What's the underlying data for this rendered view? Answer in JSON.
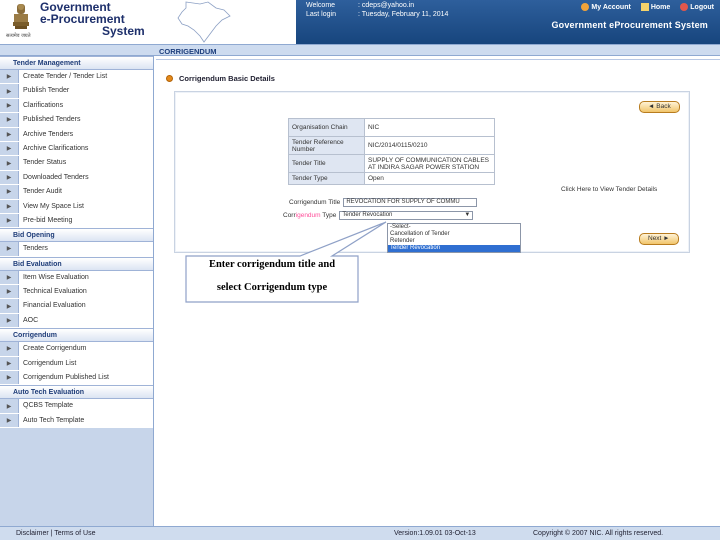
{
  "header": {
    "brand_line1": "Government",
    "brand_line2": "e-Procurement",
    "brand_line3": "System",
    "emblem_caption": "सत्यमेव जयते",
    "welcome_key": "Welcome",
    "welcome_value": ": cdeps@yahoo.in",
    "last_login_key": "Last login",
    "last_login_value": ": Tuesday, February 11, 2014",
    "links": [
      "My Account",
      "Home",
      "Logout"
    ],
    "system_title": "Government eProcurement System"
  },
  "sidebar": {
    "sections": [
      {
        "title": "Tender Management",
        "items": [
          "Create Tender / Tender List",
          "Publish Tender",
          "Clarifications",
          "Published Tenders",
          "Archive Tenders",
          "Archive Clarifications",
          "Tender Status",
          "Downloaded Tenders",
          "Tender Audit",
          "View My Space List",
          "Pre-bid Meeting"
        ]
      },
      {
        "title": "Bid Opening",
        "items": [
          "Tenders"
        ]
      },
      {
        "title": "Bid Evaluation",
        "items": [
          "Item Wise Evaluation",
          "Technical Evaluation",
          "Financial Evaluation",
          "AOC"
        ]
      },
      {
        "title": "Corrigendum",
        "items": [
          "Create Corrigendum",
          "Corrigendum List",
          "Corrigendum Published List"
        ]
      },
      {
        "title": "Auto Tech Evaluation",
        "items": [
          "QCBS Template",
          "Auto Tech Template"
        ]
      }
    ]
  },
  "main": {
    "breadcrumb": "CORRIGENDUM",
    "subtitle": "Corrigendum Basic Details",
    "back_label": "◄ Back",
    "next_label": "Next ►",
    "details": [
      {
        "k": "Organisation Chain",
        "v": "NIC"
      },
      {
        "k": "Tender Reference Number",
        "v": "NIC/2014/0115/0210"
      },
      {
        "k": "Tender Title",
        "v": "SUPPLY OF COMMUNICATION CABLES AT INDIRA SAGAR POWER STATION"
      },
      {
        "k": "Tender Type",
        "v": "Open"
      }
    ],
    "tender_details_link": "Click Here to View Tender Details",
    "corrigendum_title_label": "Corrigendum Title",
    "corrigendum_title_value": "REVOCATION FOR SUPPLY OF COMMU",
    "corrigendum_type_prefix": "Corr",
    "corrigendum_type_highlight": "igendum",
    "corrigendum_type_suffix": " Type",
    "corrigendum_type_value": "Tender Revocation",
    "dropdown_options": [
      "-Select-",
      "Cancellation of Tender",
      "Retender",
      "Tender Revocation"
    ],
    "callout_line1": "Enter corrigendum title and",
    "callout_line2": "select Corrigendum type"
  },
  "footer": {
    "disclaimer": "Disclaimer",
    "sep": " | ",
    "terms": "Terms of Use",
    "version": "Version:1.09.01 03-Oct-13",
    "copyright": "Copyright © 2007 NIC. All rights reserved."
  },
  "colors": {
    "accent": "#17457d",
    "sidebar": "#c7d5ea",
    "highlight": "#2f6fd1"
  }
}
